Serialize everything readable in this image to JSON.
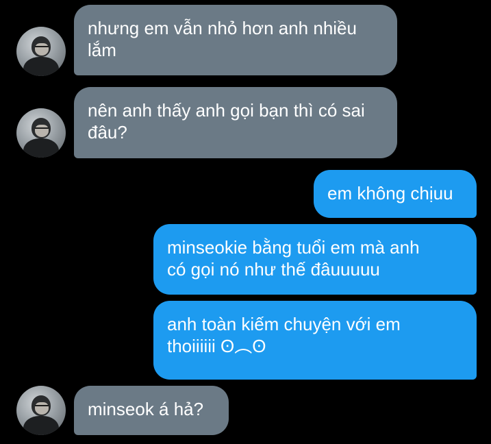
{
  "messages": [
    {
      "direction": "received",
      "text": "nhưng em vẫn nhỏ hơn anh nhiều\nlắm"
    },
    {
      "direction": "received",
      "text": "nên anh thấy anh gọi bạn thì có sai\nđâu?"
    },
    {
      "direction": "sent",
      "text": "em không chịuu"
    },
    {
      "direction": "sent",
      "text": "minseokie bằng tuổi em mà anh\ncó gọi nó như thế đâuuuuu"
    },
    {
      "direction": "sent",
      "text": "anh toàn kiếm chuyện với em\nthoiiiiii ʘ︵ʘ"
    },
    {
      "direction": "received",
      "text": "minseok á hả?"
    }
  ],
  "colors": {
    "background": "#000000",
    "received_bubble": "#6b7a86",
    "sent_bubble": "#1d9bf0",
    "text": "#ffffff"
  }
}
